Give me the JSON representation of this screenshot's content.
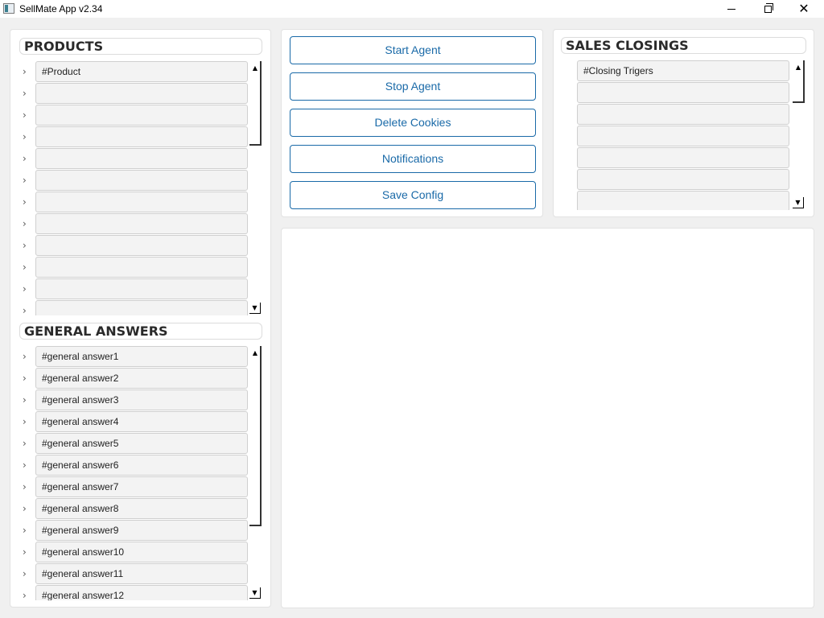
{
  "window": {
    "title": "SellMate App v2.34",
    "icons": {
      "minimize": "minimize-icon",
      "maximize": "maximize-icon",
      "close": "close-icon",
      "close_glyph": "✕"
    }
  },
  "products": {
    "header": "PRODUCTS",
    "items": [
      "#Product",
      "",
      "",
      "",
      "",
      "",
      "",
      "",
      "",
      "",
      "",
      ""
    ]
  },
  "general_answers": {
    "header": "GENERAL ANSWERS",
    "items": [
      "#general answer1",
      "#general answer2",
      "#general answer3",
      "#general answer4",
      "#general answer5",
      "#general answer6",
      "#general answer7",
      "#general answer8",
      "#general answer9",
      "#general answer10",
      "#general answer11",
      "#general answer12"
    ]
  },
  "controls": {
    "buttons": [
      "Start Agent",
      "Stop Agent",
      "Delete Cookies",
      "Notifications",
      "Save Config"
    ]
  },
  "sales_closings": {
    "header": "SALES CLOSINGS",
    "items": [
      "#Closing Trigers",
      "",
      "",
      "",
      "",
      "",
      ""
    ]
  },
  "glyphs": {
    "chevron": "›",
    "scroll_up": "▲",
    "scroll_down": "▼"
  },
  "colors": {
    "accent": "#1a6aa8",
    "field_bg": "#f3f3f3",
    "panel_bg": "#ffffff",
    "window_bg": "#f0f0f0"
  }
}
